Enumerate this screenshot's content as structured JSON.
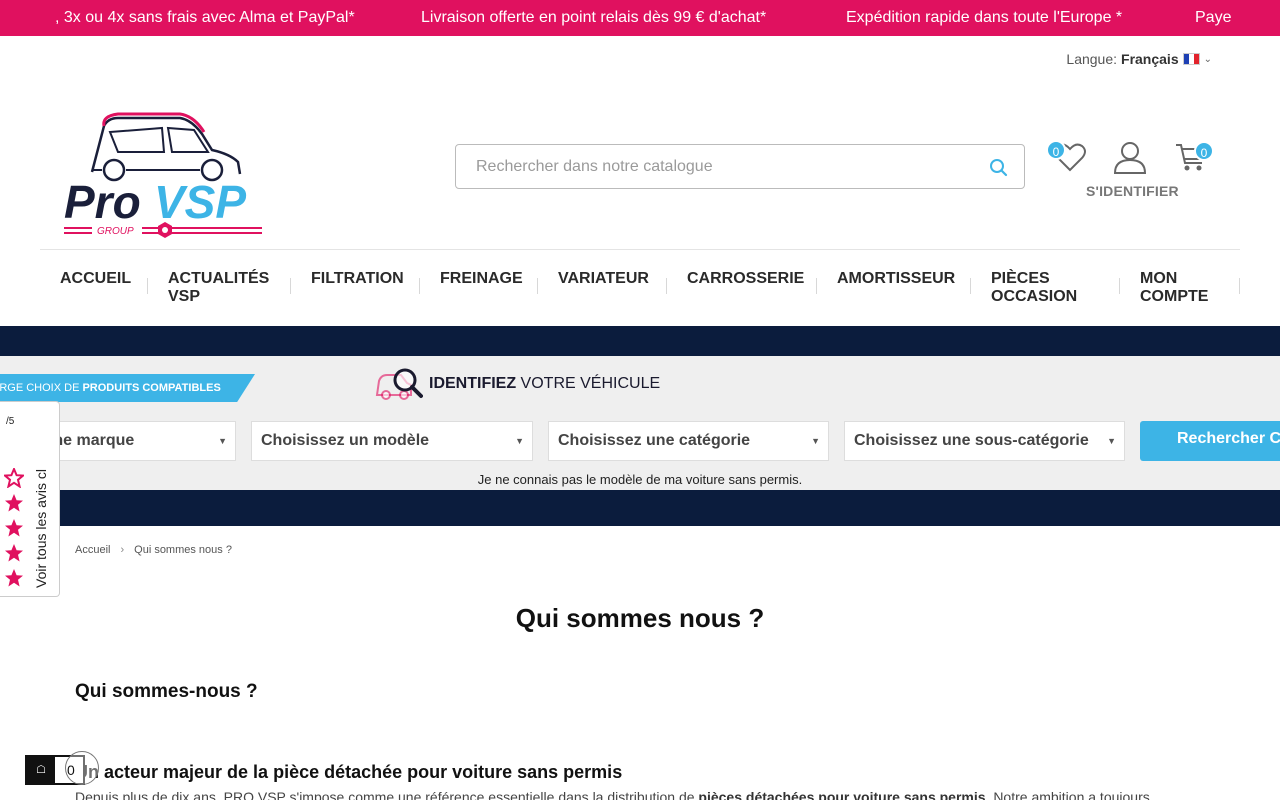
{
  "promo": {
    "items": [
      ", 3x ou 4x sans frais avec Alma et PayPal*",
      "Livraison offerte en point relais dès 99 € d'achat*",
      "Expédition rapide dans toute l'Europe *",
      "Paye"
    ]
  },
  "language": {
    "label": "Langue:",
    "value": "Français"
  },
  "logo": {
    "brand_left": "Pro",
    "brand_right": "VSP",
    "tagline": "GROUP"
  },
  "search": {
    "placeholder": "Rechercher dans notre catalogue"
  },
  "header": {
    "wishlist_count": "0",
    "login_label": "S'IDENTIFIER",
    "cart_count": "0"
  },
  "nav": {
    "items": [
      {
        "label": "ACCUEIL"
      },
      {
        "label": "ACTUALITÉS VSP"
      },
      {
        "label": "FILTRATION"
      },
      {
        "label": "FREINAGE"
      },
      {
        "label": "VARIATEUR"
      },
      {
        "label": "CARROSSERIE"
      },
      {
        "label": "AMORTISSEUR"
      },
      {
        "label": "PIÈCES OCCASION"
      },
      {
        "label": "MON COMPTE"
      }
    ]
  },
  "vehicle_selector": {
    "compat_prefix": "ARGE CHOIX DE ",
    "compat_bold": "PRODUITS COMPATIBLES",
    "identify_bold": "IDENTIFIEZ",
    "identify_rest": " VOTRE VÉHICULE",
    "selects": [
      "issez une marque",
      "Choisissez un modèle",
      "Choisissez une catégorie",
      "Choisissez une sous-catégorie"
    ],
    "submit_label": "Rechercher C",
    "unknown_link": "Je ne connais pas le modèle de ma voiture sans permis."
  },
  "reviews_widget": {
    "label": "Voir tous les avis cl",
    "top_text": "/5"
  },
  "breadcrumb": {
    "home": "Accueil",
    "current": "Qui sommes nous ?"
  },
  "content": {
    "title": "Qui sommes nous ?",
    "h2": "Qui sommes-nous ?",
    "h3": "Un acteur majeur de la pièce détachée pour voiture sans permis",
    "para_start": "Depuis plus de dix ans, PRO VSP s'impose comme une référence essentielle dans la distribution de ",
    "para_bold": "pièces détachées pour voiture sans permis",
    "para_end": ". Notre ambition a toujours"
  },
  "floating_cart": {
    "count": "0"
  },
  "colors": {
    "brand_pink": "#e0115f",
    "accent_blue": "#3db4e6",
    "dark_navy": "#0b1c3d",
    "selector_bg": "#efefef"
  }
}
